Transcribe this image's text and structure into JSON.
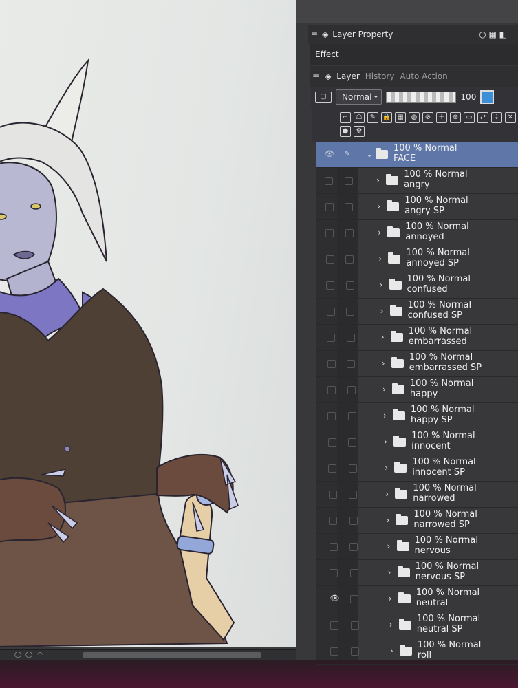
{
  "panel": {
    "tab_layer_property": "Layer Property",
    "tab_effect": "Effect",
    "tab_history": "History",
    "tab_auto_action": "Auto Action",
    "tab_layer": "Layer",
    "blend_mode": "Normal",
    "opacity_value": "100"
  },
  "layers": [
    {
      "meta": "100 % Normal",
      "name": "FACE",
      "selected": true
    },
    {
      "meta": "100 % Normal",
      "name": "angry"
    },
    {
      "meta": "100 % Normal",
      "name": "angry SP"
    },
    {
      "meta": "100 % Normal",
      "name": "annoyed"
    },
    {
      "meta": "100 % Normal",
      "name": "annoyed SP"
    },
    {
      "meta": "100 % Normal",
      "name": "confused"
    },
    {
      "meta": "100 % Normal",
      "name": "confused SP"
    },
    {
      "meta": "100 % Normal",
      "name": "embarrassed"
    },
    {
      "meta": "100 % Normal",
      "name": "embarrassed SP"
    },
    {
      "meta": "100 % Normal",
      "name": "happy"
    },
    {
      "meta": "100 % Normal",
      "name": "happy SP"
    },
    {
      "meta": "100 % Normal",
      "name": "innocent"
    },
    {
      "meta": "100 % Normal",
      "name": "innocent SP"
    },
    {
      "meta": "100 % Normal",
      "name": "narrowed"
    },
    {
      "meta": "100 % Normal",
      "name": "narrowed SP"
    },
    {
      "meta": "100 % Normal",
      "name": "nervous"
    },
    {
      "meta": "100 % Normal",
      "name": "nervous SP"
    },
    {
      "meta": "100 % Normal",
      "name": "neutral",
      "visible": true
    },
    {
      "meta": "100 % Normal",
      "name": "neutral SP"
    },
    {
      "meta": "100 % Normal",
      "name": "roll"
    }
  ],
  "icons": {
    "eye": "eye-icon",
    "pen": "pen-icon",
    "folder": "folder-icon",
    "chevron": "chevron-right-icon"
  },
  "colors": {
    "selected_row": "#5e76a8",
    "panel_bg": "#38373a",
    "canvas_bg": "#e6e8e6",
    "accent_chip": "#3d8fd8"
  }
}
